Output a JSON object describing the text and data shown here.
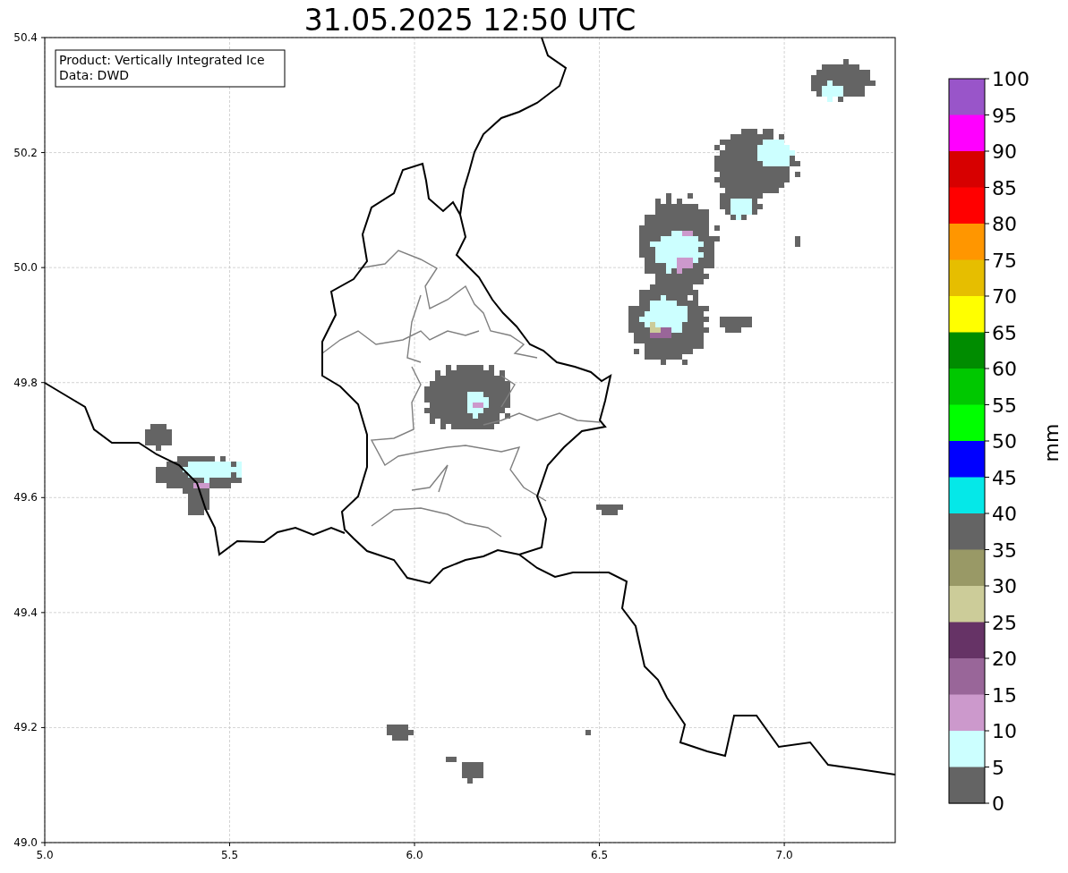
{
  "title": "31.05.2025 12:50 UTC",
  "info_box": {
    "lines": [
      "Product: Vertically Integrated Ice",
      "Data: DWD"
    ]
  },
  "map": {
    "xticks": [
      "5.0",
      "5.5",
      "6.0",
      "6.5",
      "7.0"
    ],
    "yticks": [
      "50.4",
      "50.2",
      "50.0",
      "49.8",
      "49.6",
      "49.4",
      "49.2",
      "49.0"
    ]
  },
  "colorbar": {
    "label": "mm",
    "segments": [
      {
        "color": "#9955c9"
      },
      {
        "color": "#ff00ff"
      },
      {
        "color": "#d70000"
      },
      {
        "color": "#ff0000"
      },
      {
        "color": "#ff9600"
      },
      {
        "color": "#e6be00"
      },
      {
        "color": "#ffff00"
      },
      {
        "color": "#008c00"
      },
      {
        "color": "#00c800"
      },
      {
        "color": "#00ff00"
      },
      {
        "color": "#0000ff"
      },
      {
        "color": "#05e8e8"
      },
      {
        "color": "#646464"
      },
      {
        "color": "#999966"
      },
      {
        "color": "#cccc99"
      },
      {
        "color": "#663366"
      },
      {
        "color": "#996699"
      },
      {
        "color": "#cc99cc"
      },
      {
        "color": "#ccffff"
      },
      {
        "color": "#646464"
      }
    ],
    "ticks": [
      "100",
      "95",
      "90",
      "85",
      "80",
      "75",
      "70",
      "65",
      "60",
      "55",
      "50",
      "45",
      "40",
      "35",
      "30",
      "25",
      "20",
      "15",
      "10",
      "5",
      "0"
    ]
  }
}
